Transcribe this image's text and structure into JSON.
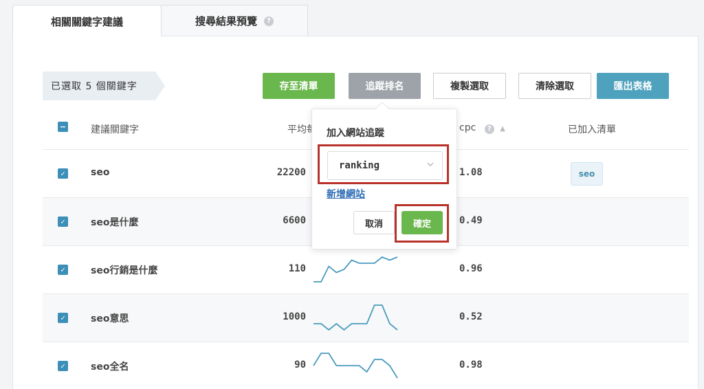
{
  "tabs": [
    {
      "label": "相關關鍵字建議"
    },
    {
      "label": "搜尋結果預覽",
      "help": "?"
    }
  ],
  "toolbar": {
    "selected_text": "已選取 5 個關鍵字",
    "save_label": "存至清單",
    "track_label": "追蹤排名",
    "copy_label": "複製選取",
    "clear_label": "清除選取",
    "export_label": "匯出表格"
  },
  "table": {
    "headers": {
      "keyword": "建議關鍵字",
      "volume": "平均每",
      "cpc": "cpc",
      "added": "已加入清單"
    },
    "rows": [
      {
        "keyword": "seo",
        "volume": "22200",
        "cpc": "1.08",
        "tag": "seo",
        "checked": true,
        "trend": []
      },
      {
        "keyword": "seo是什麼",
        "volume": "6600",
        "cpc": "0.49",
        "tag": "",
        "checked": true,
        "trend": []
      },
      {
        "keyword": "seo行銷是什麼",
        "volume": "110",
        "cpc": "0.96",
        "tag": "",
        "checked": true,
        "trend": [
          0,
          0,
          5,
          3,
          4,
          7,
          6,
          6,
          6,
          8,
          7,
          8
        ]
      },
      {
        "keyword": "seo意思",
        "volume": "1000",
        "cpc": "0.52",
        "tag": "",
        "checked": true,
        "trend": [
          5,
          5,
          4,
          5,
          4,
          5,
          5,
          5,
          8,
          8,
          5,
          4
        ]
      },
      {
        "keyword": "seo全名",
        "volume": "90",
        "cpc": "0.98",
        "tag": "",
        "checked": true,
        "trend": [
          6,
          8,
          8,
          6,
          6,
          6,
          6,
          5,
          7,
          7,
          6,
          4
        ]
      }
    ]
  },
  "popover": {
    "title": "加入網站追蹤",
    "select_value": "ranking",
    "add_site_label": "新增網站",
    "cancel_label": "取消",
    "confirm_label": "確定"
  },
  "colors": {
    "green": "#6ab74d",
    "gray": "#9ea3a9",
    "blue": "#4ea2bd",
    "checkbox": "#3d8fb8",
    "highlight": "#b8322a",
    "sparkline": "#4a9bbd"
  }
}
